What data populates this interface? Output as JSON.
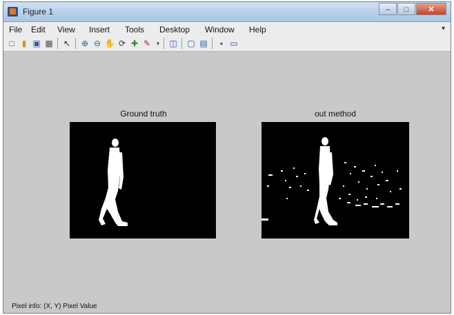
{
  "window": {
    "title": "Figure 1"
  },
  "menu": [
    "File",
    "Edit",
    "View",
    "Insert",
    "Tools",
    "Desktop",
    "Window",
    "Help"
  ],
  "toolbar_icons": [
    "new-figure-icon",
    "open-file-icon",
    "save-icon",
    "print-icon",
    "pointer-icon",
    "zoom-in-icon",
    "zoom-out-icon",
    "pan-icon",
    "rotate-3d-icon",
    "data-cursor-icon",
    "brush-icon",
    "link-plot-icon",
    "colorbar-icon",
    "legend-icon",
    "hide-plot-tools-icon",
    "show-plot-tools-icon"
  ],
  "plots": [
    {
      "title": "Ground truth",
      "image": "binary-silhouette-clean"
    },
    {
      "title": "out method",
      "image": "binary-silhouette-noisy"
    }
  ],
  "status": {
    "text": "Pixel info: (X, Y)  Pixel Value"
  },
  "colors": {
    "figure_bg": "#c9c9c9",
    "axes_bg": "#000000",
    "foreground": "#ffffff"
  }
}
